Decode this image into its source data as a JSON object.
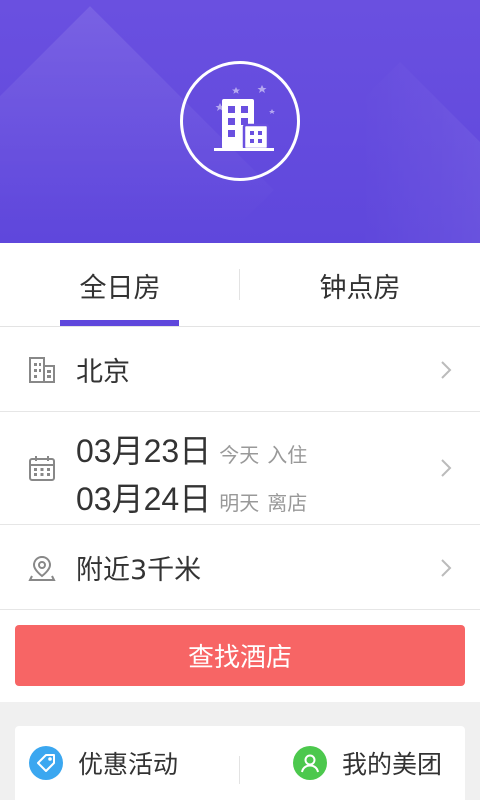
{
  "hero": {
    "logo_icon": "hotel-building-icon"
  },
  "tabs": [
    {
      "label": "全日房",
      "active": true
    },
    {
      "label": "钟点房",
      "active": false
    }
  ],
  "accent": "#5f47dc",
  "city": {
    "icon": "city-building-icon",
    "value": "北京"
  },
  "dates": {
    "icon": "calendar-icon",
    "checkin": {
      "date": "03月23日",
      "day": "今天",
      "action": "入住"
    },
    "checkout": {
      "date": "03月24日",
      "day": "明天",
      "action": "离店"
    }
  },
  "nearby": {
    "icon": "location-pin-icon",
    "value": "附近3千米"
  },
  "search_button": {
    "label": "查找酒店",
    "color": "#f76565"
  },
  "bottom_nav": [
    {
      "label": "优惠活动",
      "icon": "discount-tag-icon",
      "color": "#3ba7f0"
    },
    {
      "label": "我的美团",
      "icon": "user-profile-icon",
      "color": "#4cc84d"
    }
  ]
}
